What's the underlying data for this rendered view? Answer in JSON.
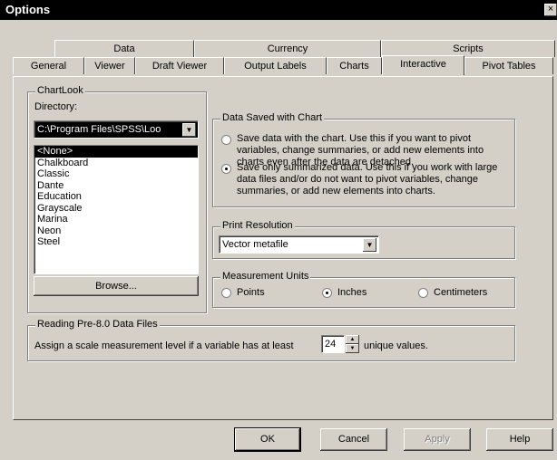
{
  "window": {
    "title": "Options",
    "close_label": "×"
  },
  "tabs_row1": [
    {
      "label": "Data"
    },
    {
      "label": "Currency"
    },
    {
      "label": "Scripts"
    }
  ],
  "tabs_row2": [
    {
      "label": "General"
    },
    {
      "label": "Viewer"
    },
    {
      "label": "Draft Viewer"
    },
    {
      "label": "Output Labels"
    },
    {
      "label": "Charts"
    },
    {
      "label": "Interactive"
    },
    {
      "label": "Pivot Tables"
    }
  ],
  "active_tab": "Interactive",
  "chartlook": {
    "group_label": "ChartLook",
    "directory_label": "Directory:",
    "directory_value": "C:\\Program Files\\SPSS\\Loo",
    "items": [
      "<None>",
      "Chalkboard",
      "Classic",
      "Dante",
      "Education",
      "Grayscale",
      "Marina",
      "Neon",
      "Steel"
    ],
    "selected": "<None>",
    "browse_label": "Browse..."
  },
  "data_saved": {
    "group_label": "Data Saved with Chart",
    "option_all": "Save data with the chart. Use this if you want to pivot variables, change summaries, or add new elements into charts even after the data are detached.",
    "option_summarized": "Save only summarized data. Use this if you work with large data files and/or do not want to pivot variables, change summaries, or add new elements into charts.",
    "selected": "summarized"
  },
  "print_resolution": {
    "group_label": "Print Resolution",
    "value": "Vector metafile"
  },
  "measurement_units": {
    "group_label": "Measurement Units",
    "points": "Points",
    "inches": "Inches",
    "centimeters": "Centimeters",
    "selected": "inches"
  },
  "reading_pre": {
    "group_label": "Reading Pre-8.0 Data Files",
    "text_before": "Assign a scale measurement level if a variable has at least",
    "value": "24",
    "text_after": "unique values."
  },
  "buttons": {
    "ok": "OK",
    "cancel": "Cancel",
    "apply": "Apply",
    "help": "Help"
  }
}
